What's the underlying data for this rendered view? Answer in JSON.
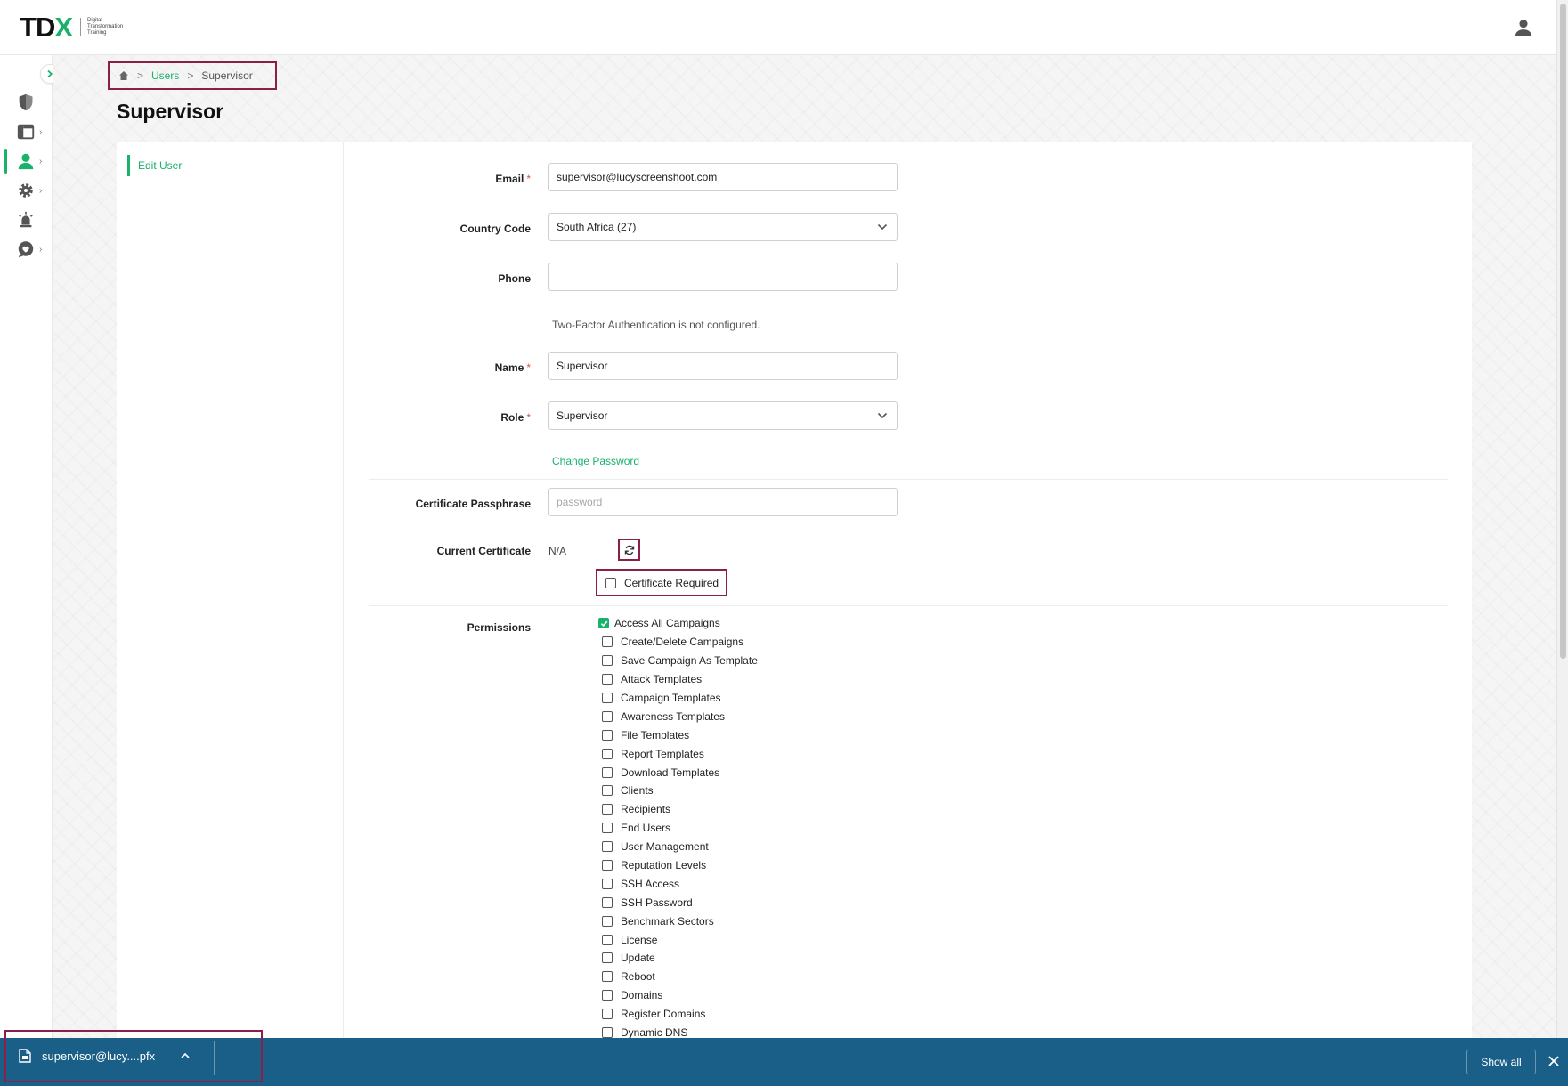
{
  "app": {
    "logo_mark": {
      "t": "T",
      "d": "D",
      "x": "X"
    },
    "logo_sub": [
      "Digital",
      "Transformation",
      "Training"
    ],
    "accent_color": "#1ab26b",
    "highlight_color": "#8a1f4a"
  },
  "breadcrumb": {
    "home_icon": "home-icon",
    "separator": ">",
    "items": [
      "Users",
      "Supervisor"
    ]
  },
  "page": {
    "title": "Supervisor"
  },
  "tabs": {
    "edit_user": "Edit User"
  },
  "form": {
    "email": {
      "label": "Email",
      "required": "*",
      "value": "supervisor@lucyscreenshoot.com"
    },
    "country_code": {
      "label": "Country Code",
      "value": "South Africa (27)"
    },
    "phone": {
      "label": "Phone",
      "value": ""
    },
    "two_factor_note": "Two-Factor Authentication is not configured.",
    "name": {
      "label": "Name",
      "required": "*",
      "value": "Supervisor"
    },
    "role": {
      "label": "Role",
      "required": "*",
      "value": "Supervisor"
    },
    "change_password": "Change Password",
    "certificate_passphrase": {
      "label": "Certificate Passphrase",
      "placeholder": "password"
    },
    "current_certificate": {
      "label": "Current Certificate",
      "value": "N/A"
    },
    "certificate_required": {
      "label": "Certificate Required",
      "checked": false
    },
    "permissions": {
      "label": "Permissions",
      "items": [
        {
          "label": "Access All Campaigns",
          "checked": true
        },
        {
          "label": "Create/Delete Campaigns",
          "checked": false
        },
        {
          "label": "Save Campaign As Template",
          "checked": false
        },
        {
          "label": "Attack Templates",
          "checked": false
        },
        {
          "label": "Campaign Templates",
          "checked": false
        },
        {
          "label": "Awareness Templates",
          "checked": false
        },
        {
          "label": "File Templates",
          "checked": false
        },
        {
          "label": "Report Templates",
          "checked": false
        },
        {
          "label": "Download Templates",
          "checked": false
        },
        {
          "label": "Clients",
          "checked": false
        },
        {
          "label": "Recipients",
          "checked": false
        },
        {
          "label": "End Users",
          "checked": false
        },
        {
          "label": "User Management",
          "checked": false
        },
        {
          "label": "Reputation Levels",
          "checked": false
        },
        {
          "label": "SSH Access",
          "checked": false
        },
        {
          "label": "SSH Password",
          "checked": false
        },
        {
          "label": "Benchmark Sectors",
          "checked": false
        },
        {
          "label": "License",
          "checked": false
        },
        {
          "label": "Update",
          "checked": false
        },
        {
          "label": "Reboot",
          "checked": false
        },
        {
          "label": "Domains",
          "checked": false
        },
        {
          "label": "Register Domains",
          "checked": false
        },
        {
          "label": "Dynamic DNS",
          "checked": false
        }
      ]
    }
  },
  "downloads": {
    "file_name": "supervisor@lucy....pfx",
    "show_all": "Show all"
  }
}
